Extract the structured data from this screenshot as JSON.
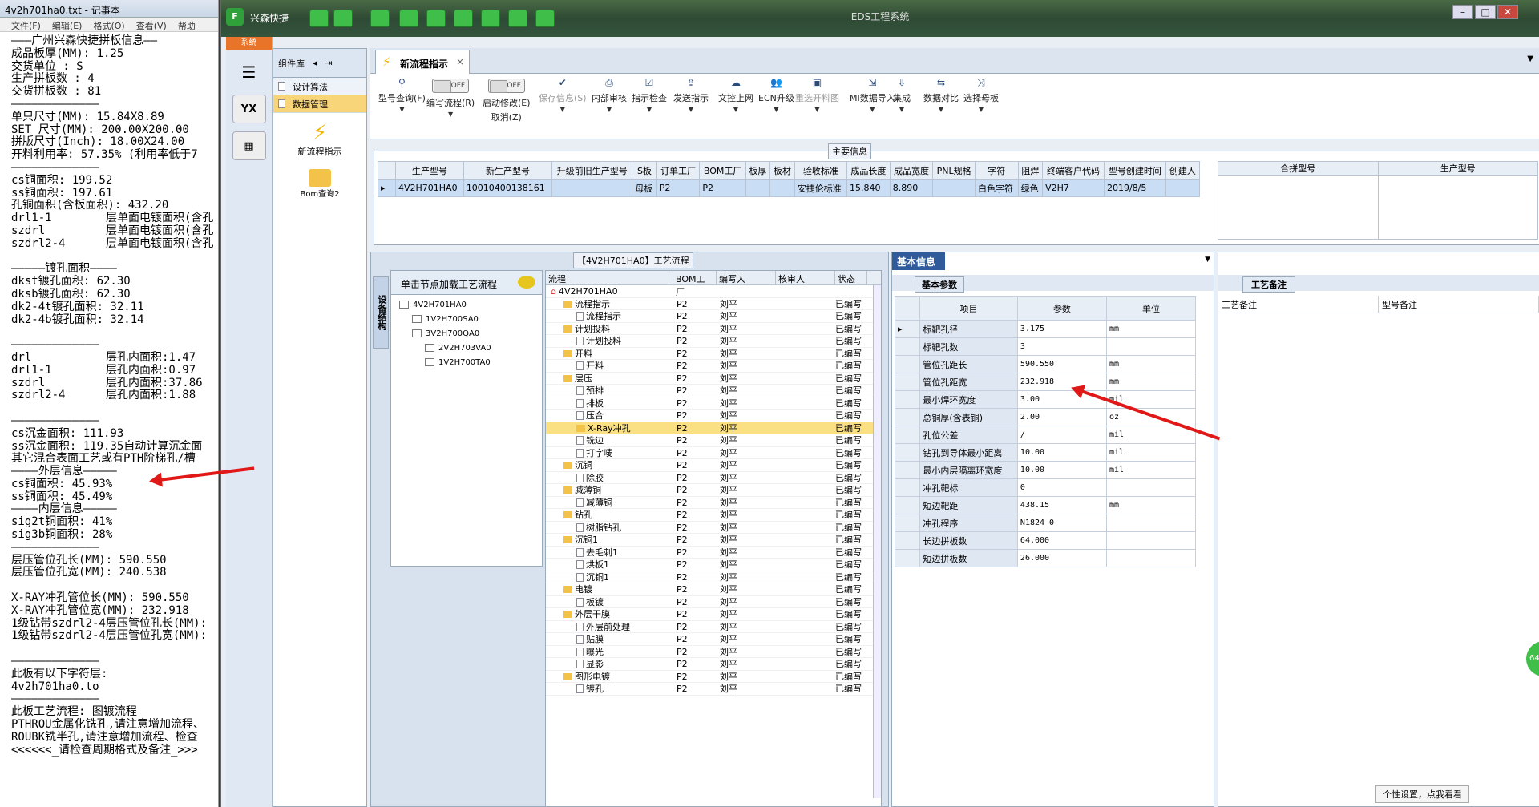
{
  "notepad": {
    "title": "4v2h701ha0.txt - 记事本",
    "menu": [
      "文件(F)",
      "编辑(E)",
      "格式(O)",
      "查看(V)",
      "帮助"
    ],
    "lines": [
      "———广州兴森快捷拼板信息——",
      "成品板厚(MM): 1.25",
      "交货单位 : S",
      "生产拼板数 : 4",
      "交货拼板数 : 81",
      "—————————————",
      "单只尺寸(MM): 15.84X8.89",
      "SET 尺寸(MM): 200.00X200.00",
      "拼版尺寸(Inch): 18.00X24.00",
      "开料利用率: 57.35% (利用率低于7",
      "—————————————",
      "cs铜面积: 199.52",
      "ss铜面积: 197.61",
      "孔铜面积(含板面积): 432.20",
      "drl1-1        层单面电镀面积(含孔",
      "szdrl         层单面电镀面积(含孔",
      "szdrl2-4      层单面电镀面积(含孔",
      "",
      "—————镀孔面积————",
      "dkst镀孔面积: 62.30",
      "dksb镀孔面积: 62.30",
      "dk2-4t镀孔面积: 32.11",
      "dk2-4b镀孔面积: 32.14",
      "",
      "—————————————",
      "drl           层孔内面积:1.47",
      "drl1-1        层孔内面积:0.97",
      "szdrl         层孔内面积:37.86",
      "szdrl2-4      层孔内面积:1.88",
      "",
      "—————————————",
      "cs沉金面积: 111.93",
      "ss沉金面积: 119.35自动计算沉金面",
      "其它混合表面工艺或有PTH阶梯孔/槽",
      "————外层信息—————",
      "cs铜面积: 45.93%",
      "ss铜面积: 45.49%",
      "————内层信息—————",
      "sig2t铜面积: 41%",
      "sig3b铜面积: 28%",
      "—————————————",
      "层压管位孔长(MM): 590.550",
      "层压管位孔宽(MM): 240.538",
      "",
      "X-RAY冲孔管位长(MM): 590.550",
      "X-RAY冲孔管位宽(MM): 232.918",
      "1级钻带szdrl2-4层压管位孔长(MM):",
      "1级钻带szdrl2-4层压管位孔宽(MM):",
      "",
      "—————————————",
      "此板有以下字符层:",
      "4v2h701ha0.to",
      "—————————————",
      "此板工艺流程: 图镀流程",
      "PTHROU金属化铣孔,请注意增加流程、",
      "ROUBK铣半孔,请注意增加流程、检查",
      "<<<<<<_请检查周期格式及备注_>>>"
    ]
  },
  "app": {
    "name": "兴森快捷",
    "window_title": "EDS工程系统",
    "sys_tab": "系统",
    "sys_icon_label": "YX"
  },
  "component_panel": {
    "title": "组件库",
    "items": [
      "设计算法",
      "数据管理"
    ],
    "big_items": [
      "新流程指示",
      "Bom查询2"
    ]
  },
  "doc_tab": {
    "label": "新流程指示",
    "close": "×"
  },
  "ribbon": {
    "items": [
      {
        "label": "型号查询(F)",
        "icon": "search-icon"
      },
      {
        "label": "编写流程(R)",
        "toggle": "OFF"
      },
      {
        "label": "启动修改(E)",
        "toggle": "OFF",
        "sub": "取消(Z)"
      },
      {
        "label": "保存信息(S)",
        "icon": "check-icon",
        "disabled": true
      },
      {
        "label": "内部审核",
        "icon": "print-icon"
      },
      {
        "label": "指示检查",
        "icon": "checkbox-icon"
      },
      {
        "label": "发送指示",
        "icon": "upload-icon"
      },
      {
        "label": "文控上网",
        "icon": "cloud-upload-icon"
      },
      {
        "label": "ECN升级",
        "icon": "people-icon"
      },
      {
        "label": "重选开料图",
        "icon": "image-icon",
        "disabled": true
      },
      {
        "label": "MI数据导入",
        "icon": "import-icon"
      },
      {
        "label": "集成",
        "icon": "download-icon"
      },
      {
        "label": "数据对比",
        "icon": "compare-icon"
      },
      {
        "label": "选择母板",
        "icon": "shuffle-icon"
      }
    ]
  },
  "main_info": {
    "title": "主要信息",
    "columns": [
      "生产型号",
      "新生产型号",
      "升级前旧生产型号",
      "S板",
      "订单工厂",
      "BOM工厂",
      "板厚",
      "板材",
      "验收标准",
      "成品长度",
      "成品宽度",
      "PNL规格",
      "字符",
      "阻焊",
      "终端客户代码",
      "型号创建时间",
      "创建人"
    ],
    "row": [
      "4V2H701HA0",
      "10010400138161",
      "",
      "母板",
      "P2",
      "P2",
      "",
      "",
      "安捷伦标准",
      "15.840",
      "8.890",
      "",
      "白色字符",
      "绿色",
      "V2H7",
      "2019/8/5",
      ""
    ],
    "side_columns": [
      "合拼型号",
      "生产型号"
    ]
  },
  "process": {
    "title": "【4V2H701HA0】工艺流程",
    "vertical_tab": "设备结构",
    "left_header": "单击节点加载工艺流程",
    "left_tree": [
      {
        "label": "4V2H701HA0",
        "level": 0
      },
      {
        "label": "1V2H700SA0",
        "level": 1
      },
      {
        "label": "3V2H700QA0",
        "level": 1
      },
      {
        "label": "2V2H703VA0",
        "level": 2
      },
      {
        "label": "1V2H700TA0",
        "level": 2
      }
    ],
    "columns": [
      "流程",
      "BOM工厂",
      "编写人",
      "核审人",
      "状态"
    ],
    "rows": [
      {
        "label": "4V2H701HA0",
        "level": 0,
        "type": "home",
        "bom": "",
        "writer": ""
      },
      {
        "label": "流程指示",
        "level": 1,
        "type": "folder",
        "bom": "P2",
        "writer": "刘平"
      },
      {
        "label": "流程指示",
        "level": 2,
        "type": "doc",
        "bom": "P2",
        "writer": "刘平"
      },
      {
        "label": "计划投料",
        "level": 1,
        "type": "folder",
        "bom": "P2",
        "writer": "刘平"
      },
      {
        "label": "计划投料",
        "level": 2,
        "type": "doc",
        "bom": "P2",
        "writer": "刘平"
      },
      {
        "label": "开料",
        "level": 1,
        "type": "folder",
        "bom": "P2",
        "writer": "刘平"
      },
      {
        "label": "开料",
        "level": 2,
        "type": "doc",
        "bom": "P2",
        "writer": "刘平"
      },
      {
        "label": "层压",
        "level": 1,
        "type": "folder",
        "bom": "P2",
        "writer": "刘平"
      },
      {
        "label": "预排",
        "level": 2,
        "type": "doc",
        "bom": "P2",
        "writer": "刘平"
      },
      {
        "label": "排板",
        "level": 2,
        "type": "doc",
        "bom": "P2",
        "writer": "刘平"
      },
      {
        "label": "压合",
        "level": 2,
        "type": "doc",
        "bom": "P2",
        "writer": "刘平"
      },
      {
        "label": "X-Ray冲孔",
        "level": 2,
        "type": "folder",
        "bom": "P2",
        "writer": "刘平",
        "selected": true
      },
      {
        "label": "铣边",
        "level": 2,
        "type": "doc",
        "bom": "P2",
        "writer": "刘平"
      },
      {
        "label": "打字唛",
        "level": 2,
        "type": "doc",
        "bom": "P2",
        "writer": "刘平"
      },
      {
        "label": "沉铜",
        "level": 1,
        "type": "folder",
        "bom": "P2",
        "writer": "刘平"
      },
      {
        "label": "除胶",
        "level": 2,
        "type": "doc",
        "bom": "P2",
        "writer": "刘平"
      },
      {
        "label": "减薄铜",
        "level": 1,
        "type": "folder",
        "bom": "P2",
        "writer": "刘平"
      },
      {
        "label": "减薄铜",
        "level": 2,
        "type": "doc",
        "bom": "P2",
        "writer": "刘平"
      },
      {
        "label": "钻孔",
        "level": 1,
        "type": "folder",
        "bom": "P2",
        "writer": "刘平"
      },
      {
        "label": "树脂钻孔",
        "level": 2,
        "type": "doc",
        "bom": "P2",
        "writer": "刘平"
      },
      {
        "label": "沉铜1",
        "level": 1,
        "type": "folder",
        "bom": "P2",
        "writer": "刘平"
      },
      {
        "label": "去毛刺1",
        "level": 2,
        "type": "doc",
        "bom": "P2",
        "writer": "刘平"
      },
      {
        "label": "烘板1",
        "level": 2,
        "type": "doc",
        "bom": "P2",
        "writer": "刘平"
      },
      {
        "label": "沉铜1",
        "level": 2,
        "type": "doc",
        "bom": "P2",
        "writer": "刘平"
      },
      {
        "label": "电镀",
        "level": 1,
        "type": "folder",
        "bom": "P2",
        "writer": "刘平"
      },
      {
        "label": "板镀",
        "level": 2,
        "type": "doc",
        "bom": "P2",
        "writer": "刘平"
      },
      {
        "label": "外层干膜",
        "level": 1,
        "type": "folder",
        "bom": "P2",
        "writer": "刘平"
      },
      {
        "label": "外层前处理",
        "level": 2,
        "type": "doc",
        "bom": "P2",
        "writer": "刘平"
      },
      {
        "label": "贴膜",
        "level": 2,
        "type": "doc",
        "bom": "P2",
        "writer": "刘平"
      },
      {
        "label": "曝光",
        "level": 2,
        "type": "doc",
        "bom": "P2",
        "writer": "刘平"
      },
      {
        "label": "显影",
        "level": 2,
        "type": "doc",
        "bom": "P2",
        "writer": "刘平"
      },
      {
        "label": "图形电镀",
        "level": 1,
        "type": "folder",
        "bom": "P2",
        "writer": "刘平"
      },
      {
        "label": "镀孔",
        "level": 2,
        "type": "doc",
        "bom": "P2",
        "writer": "刘平"
      }
    ],
    "status_text": "已编写"
  },
  "basic_info": {
    "tab": "基本信息",
    "sub_tab": "基本参数",
    "columns": [
      "项目",
      "参数",
      "单位"
    ],
    "rows": [
      [
        "标靶孔径",
        "3.175",
        "mm"
      ],
      [
        "标靶孔数",
        "3",
        ""
      ],
      [
        "管位孔距长",
        "590.550",
        "mm"
      ],
      [
        "管位孔距宽",
        "232.918",
        "mm"
      ],
      [
        "最小焊环宽度",
        "3.00",
        "mil"
      ],
      [
        "总铜厚(含表铜)",
        "2.00",
        "oz"
      ],
      [
        "孔位公差",
        "/",
        "mil"
      ],
      [
        "钻孔到导体最小距离",
        "10.00",
        "mil"
      ],
      [
        "最小内层隔离环宽度",
        "10.00",
        "mil"
      ],
      [
        "冲孔靶标",
        "0",
        ""
      ],
      [
        "短边靶距",
        "438.15",
        "mm"
      ],
      [
        "冲孔程序",
        "N1824_0",
        ""
      ],
      [
        "长边拼板数",
        "64.000",
        ""
      ],
      [
        "短边拼板数",
        "26.000",
        ""
      ]
    ]
  },
  "notes": {
    "tab": "工艺备注",
    "columns": [
      "工艺备注",
      "型号备注"
    ]
  },
  "footer": {
    "personal": "个性设置，点我看看",
    "badge": "64"
  },
  "colors": {
    "accent": "#2f5b9a",
    "arrow": "#e01818",
    "selection": "#fbdf83"
  }
}
